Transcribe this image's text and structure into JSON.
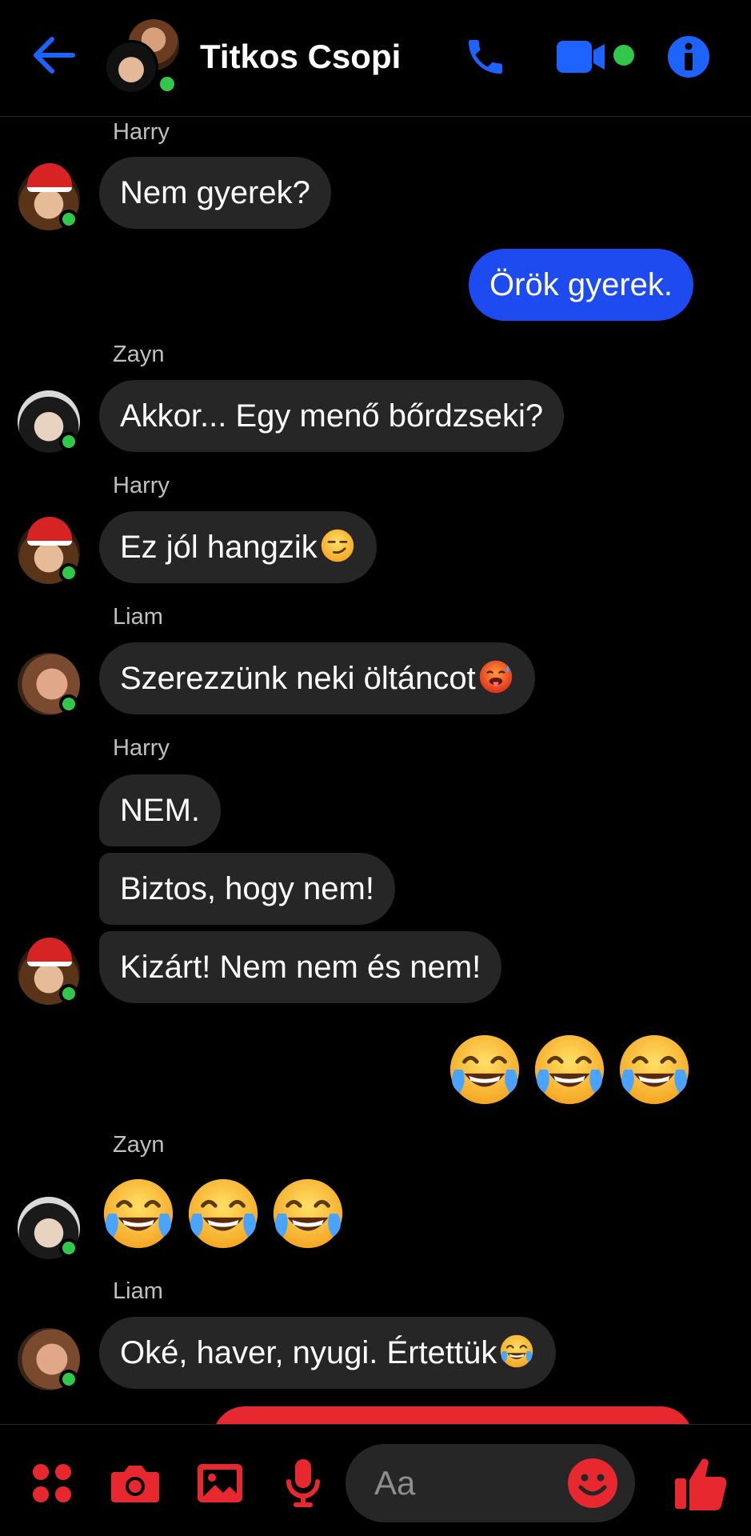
{
  "header": {
    "title": "Titkos Csopi"
  },
  "colors": {
    "accent": "#1d63ff",
    "mine_bubble": "#1d4bf0",
    "other_bubble": "#262626",
    "online": "#31c84a",
    "composer_icon": "#e7292f"
  },
  "messages": [
    {
      "sender": "Harry",
      "text": "Nem gyerek?"
    },
    {
      "mine": true,
      "text": "Örök gyerek."
    },
    {
      "sender": "Zayn",
      "text": "Akkor... Egy menő bőrdzseki?"
    },
    {
      "sender": "Harry",
      "text": "Ez jól hangzik",
      "emoji": "smirk"
    },
    {
      "sender": "Liam",
      "text": "Szerezzünk neki öltáncot",
      "emoji": "hot-face"
    },
    {
      "sender": "Harry",
      "texts": [
        "NEM.",
        "Biztos, hogy nem!",
        "Kizárt! Nem nem és nem!"
      ]
    },
    {
      "mine": true,
      "emoji_only": [
        "joy",
        "joy",
        "joy"
      ]
    },
    {
      "sender": "Zayn",
      "emoji_only": [
        "joy",
        "joy",
        "joy"
      ]
    },
    {
      "sender": "Liam",
      "text": "Oké, haver, nyugi. Értettük",
      "emoji": "joy"
    }
  ],
  "composer": {
    "placeholder": "Aa"
  }
}
